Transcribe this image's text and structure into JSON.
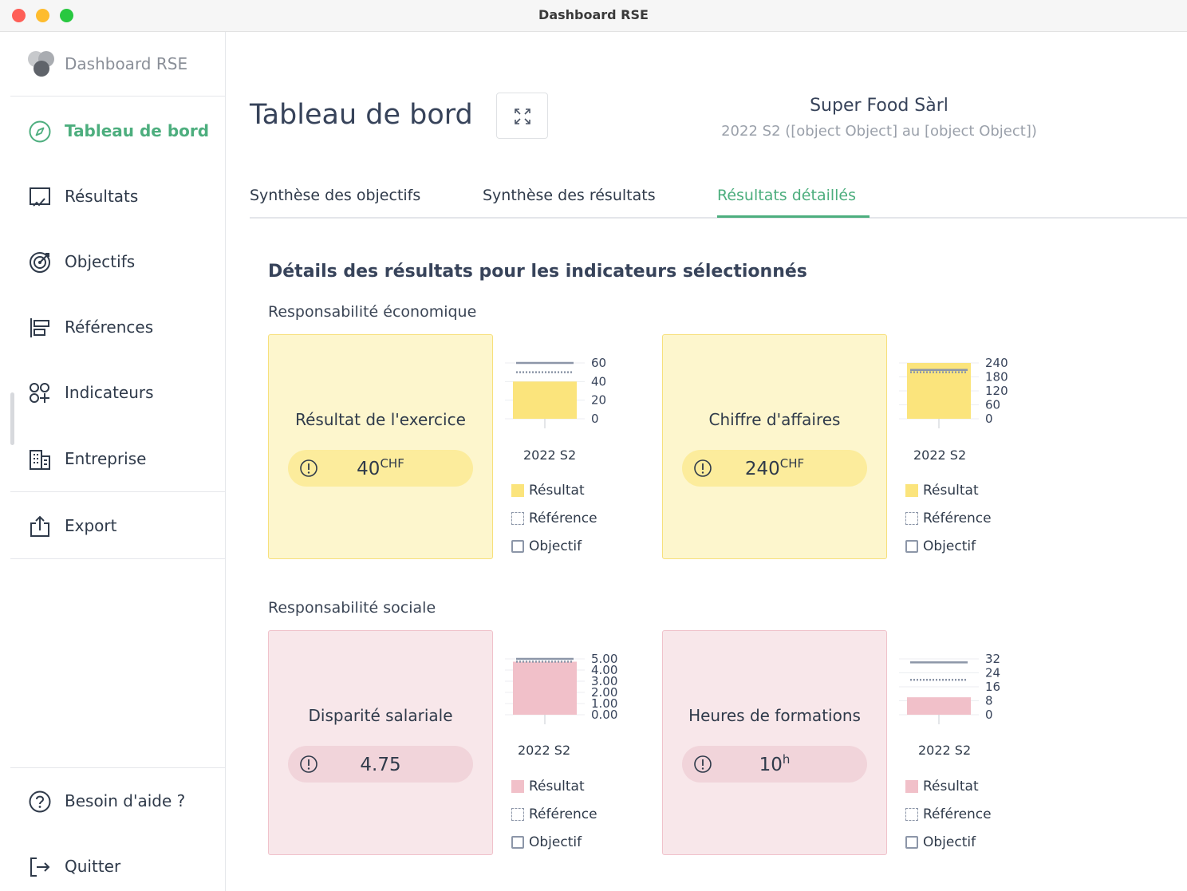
{
  "window": {
    "title": "Dashboard RSE"
  },
  "sidebar": {
    "brand": "Dashboard RSE",
    "items": [
      {
        "label": "Tableau de bord",
        "icon": "compass-icon",
        "active": true
      },
      {
        "label": "Résultats",
        "icon": "chart-check-icon"
      },
      {
        "label": "Objectifs",
        "icon": "target-icon"
      },
      {
        "label": "Références",
        "icon": "align-bars-icon"
      },
      {
        "label": "Indicateurs",
        "icon": "shapes-icon"
      },
      {
        "label": "Entreprise",
        "icon": "building-icon"
      },
      {
        "label": "Export",
        "icon": "share-icon"
      }
    ],
    "help": "Besoin d'aide ?",
    "quit": "Quitter"
  },
  "header": {
    "title": "Tableau de bord",
    "company": "Super Food Sàrl",
    "period": "2022 S2 ([object Object] au [object Object])"
  },
  "tabs": [
    {
      "label": "Synthèse des objectifs"
    },
    {
      "label": "Synthèse des résultats"
    },
    {
      "label": "Résultats détaillés",
      "active": true
    }
  ],
  "details": {
    "title": "Détails des résultats pour les indicateurs sélectionnés",
    "groups": [
      {
        "name": "Responsabilité économique",
        "color": "#fdf6cd",
        "cards": [
          {
            "title": "Résultat de l'exercice",
            "value": "40",
            "unit": "CHF"
          },
          {
            "title": "Chiffre d'affaires",
            "value": "240",
            "unit": "CHF"
          }
        ]
      },
      {
        "name": "Responsabilité sociale",
        "color": "#f8e7ea",
        "cards": [
          {
            "title": "Disparité salariale",
            "value": "4.75",
            "unit": ""
          },
          {
            "title": "Heures de formations",
            "value": "10",
            "unit": "h"
          }
        ]
      }
    ],
    "legend": {
      "result": "Résultat",
      "reference": "Référence",
      "objective": "Objectif"
    }
  },
  "chart_data": [
    {
      "type": "bar",
      "categories": [
        "2022 S2"
      ],
      "result": 40,
      "reference": 50,
      "objective": 60,
      "ticks": [
        "60",
        "40",
        "20",
        "0"
      ],
      "ylim": [
        0,
        60
      ],
      "result_color": "#fbe47c"
    },
    {
      "type": "bar",
      "categories": [
        "2022 S2"
      ],
      "result": 240,
      "reference": 200,
      "objective": 210,
      "ticks": [
        "240",
        "180",
        "120",
        "60",
        "0"
      ],
      "ylim": [
        0,
        240
      ],
      "result_color": "#fbe47c"
    },
    {
      "type": "bar",
      "categories": [
        "2022 S2"
      ],
      "result": 4.75,
      "reference": 4.75,
      "objective": 5,
      "ticks": [
        "5.00",
        "4.00",
        "3.00",
        "2.00",
        "1.00",
        "0.00"
      ],
      "ylim": [
        0,
        5
      ],
      "result_color": "#f1c0c9"
    },
    {
      "type": "bar",
      "categories": [
        "2022 S2"
      ],
      "result": 10,
      "reference": 20,
      "objective": 30,
      "ticks": [
        "32",
        "24",
        "16",
        "8",
        "0"
      ],
      "ylim": [
        0,
        32
      ],
      "result_color": "#f1c0c9"
    }
  ]
}
